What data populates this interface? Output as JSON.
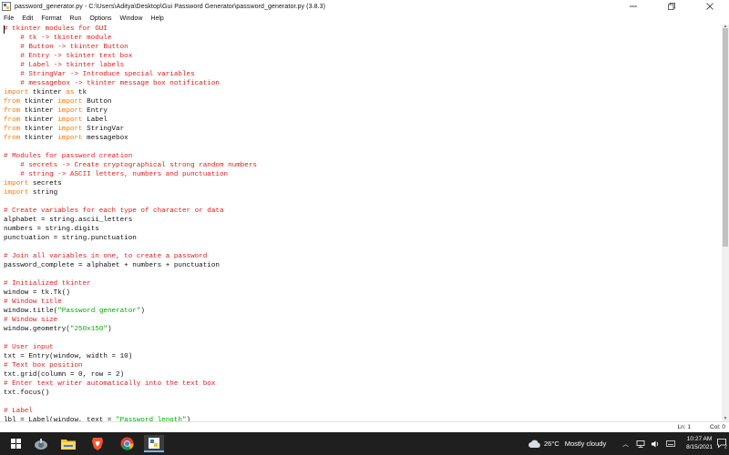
{
  "window": {
    "title": "password_generator.py - C:\\Users\\Aditya\\Desktop\\Gui Password Generator\\password_generator.py (3.8.3)",
    "minimize_icon": "minimize-icon",
    "maximize_icon": "restore-icon",
    "close_icon": "close-icon"
  },
  "menu": {
    "items": [
      "File",
      "Edit",
      "Format",
      "Run",
      "Options",
      "Window",
      "Help"
    ]
  },
  "editor": {
    "lines": [
      [
        [
          "c",
          "# tkinter modules for GUI"
        ]
      ],
      [
        [
          "c",
          "    # tk -> tkinter module"
        ]
      ],
      [
        [
          "c",
          "    # Button -> tkinter Button"
        ]
      ],
      [
        [
          "c",
          "    # Entry -> tkinter text box"
        ]
      ],
      [
        [
          "c",
          "    # Label -> tkinter labels"
        ]
      ],
      [
        [
          "c",
          "    # StringVar -> Introduce special variables"
        ]
      ],
      [
        [
          "c",
          "    # messagebox -> tkinter message box notification"
        ]
      ],
      [
        [
          "k",
          "import"
        ],
        [
          "t",
          " tkinter "
        ],
        [
          "k",
          "as"
        ],
        [
          "t",
          " tk"
        ]
      ],
      [
        [
          "k",
          "from"
        ],
        [
          "t",
          " tkinter "
        ],
        [
          "k",
          "import"
        ],
        [
          "t",
          " Button"
        ]
      ],
      [
        [
          "k",
          "from"
        ],
        [
          "t",
          " tkinter "
        ],
        [
          "k",
          "import"
        ],
        [
          "t",
          " Entry"
        ]
      ],
      [
        [
          "k",
          "from"
        ],
        [
          "t",
          " tkinter "
        ],
        [
          "k",
          "import"
        ],
        [
          "t",
          " Label"
        ]
      ],
      [
        [
          "k",
          "from"
        ],
        [
          "t",
          " tkinter "
        ],
        [
          "k",
          "import"
        ],
        [
          "t",
          " StringVar"
        ]
      ],
      [
        [
          "k",
          "from"
        ],
        [
          "t",
          " tkinter "
        ],
        [
          "k",
          "import"
        ],
        [
          "t",
          " messagebox"
        ]
      ],
      [],
      [
        [
          "c",
          "# Modules for password creation"
        ]
      ],
      [
        [
          "c",
          "    # secrets -> Create cryptographical strong random numbers"
        ]
      ],
      [
        [
          "c",
          "    # string -> ASCII letters, numbers and punctuation"
        ]
      ],
      [
        [
          "k",
          "import"
        ],
        [
          "t",
          " secrets"
        ]
      ],
      [
        [
          "k",
          "import"
        ],
        [
          "t",
          " string"
        ]
      ],
      [],
      [
        [
          "c",
          "# Create variables for each type of character or data"
        ]
      ],
      [
        [
          "t",
          "alphabet = string.ascii_letters"
        ]
      ],
      [
        [
          "t",
          "numbers = string.digits"
        ]
      ],
      [
        [
          "t",
          "punctuation = string.punctuation"
        ]
      ],
      [],
      [
        [
          "c",
          "# Join all variables in one, to create a password"
        ]
      ],
      [
        [
          "t",
          "password_complete = alphabet + numbers + punctuation"
        ]
      ],
      [],
      [
        [
          "c",
          "# Initialized tkinter"
        ]
      ],
      [
        [
          "t",
          "window = tk.Tk()"
        ]
      ],
      [
        [
          "c",
          "# Window title"
        ]
      ],
      [
        [
          "t",
          "window.title("
        ],
        [
          "s",
          "\"Password generator\""
        ],
        [
          "t",
          ")"
        ]
      ],
      [
        [
          "c",
          "# Window size"
        ]
      ],
      [
        [
          "t",
          "window.geometry("
        ],
        [
          "s",
          "\"250x150\""
        ],
        [
          "t",
          ")"
        ]
      ],
      [],
      [
        [
          "c",
          "# User input"
        ]
      ],
      [
        [
          "t",
          "txt = Entry(window, width = 10)"
        ]
      ],
      [
        [
          "c",
          "# Text box position"
        ]
      ],
      [
        [
          "t",
          "txt.grid(column = 0, row = 2)"
        ]
      ],
      [
        [
          "c",
          "# Enter text writer automatically into the text box"
        ]
      ],
      [
        [
          "t",
          "txt.focus()"
        ]
      ],
      [],
      [
        [
          "c",
          "# Label"
        ]
      ],
      [
        [
          "t",
          "lbl = Label(window, text = "
        ],
        [
          "s",
          "\"Password length\""
        ],
        [
          "t",
          ")"
        ]
      ]
    ]
  },
  "status": {
    "line": "Ln: 1",
    "col": "Col: 0"
  },
  "taskbar": {
    "apps": [
      "start-windows-icon",
      "explorer-icon",
      "file-explorer-icon",
      "brave-browser-icon",
      "chrome-icon",
      "idle-python-icon"
    ],
    "weather_temp": "26°C",
    "weather_text": "Mostly cloudy",
    "time": "10:27 AM",
    "date": "8/15/2021"
  },
  "colors": {
    "comment": "#dd1f1f",
    "keyword": "#ff7700",
    "string": "#00aa00",
    "taskbar": "#1f1f1f"
  }
}
